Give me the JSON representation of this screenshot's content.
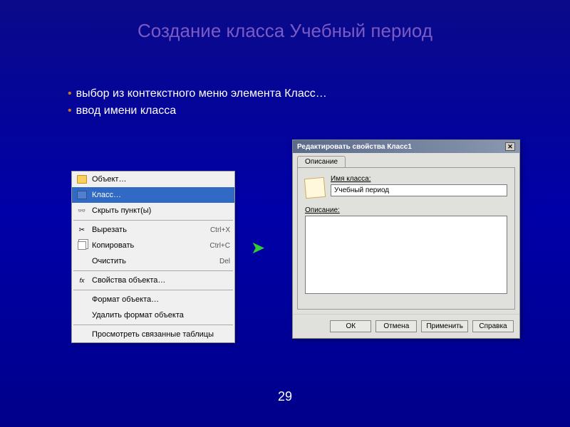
{
  "slide": {
    "title": "Создание класса Учебный период",
    "page_number": "29"
  },
  "bullets": [
    "выбор из контекстного меню элемента Класс…",
    "ввод имени класса"
  ],
  "context_menu": {
    "items": [
      {
        "label": "Объект…",
        "shortcut": ""
      },
      {
        "label": "Класс…",
        "shortcut": ""
      },
      {
        "label": "Скрыть пункт(ы)",
        "shortcut": ""
      },
      {
        "label": "Вырезать",
        "shortcut": "Ctrl+X"
      },
      {
        "label": "Копировать",
        "shortcut": "Ctrl+C"
      },
      {
        "label": "Очистить",
        "shortcut": "Del"
      },
      {
        "label": "Свойства объекта…",
        "shortcut": ""
      },
      {
        "label": "Формат объекта…",
        "shortcut": ""
      },
      {
        "label": "Удалить формат объекта",
        "shortcut": ""
      },
      {
        "label": "Просмотреть связанные таблицы",
        "shortcut": ""
      }
    ]
  },
  "dialog": {
    "title": "Редактировать свойства Класс1",
    "tab": "Описание",
    "name_label": "Имя класса:",
    "name_value": "Учебный период",
    "desc_label": "Описание:",
    "desc_value": "",
    "buttons": {
      "ok": "ОК",
      "cancel": "Отмена",
      "apply": "Применить",
      "help": "Справка"
    }
  }
}
